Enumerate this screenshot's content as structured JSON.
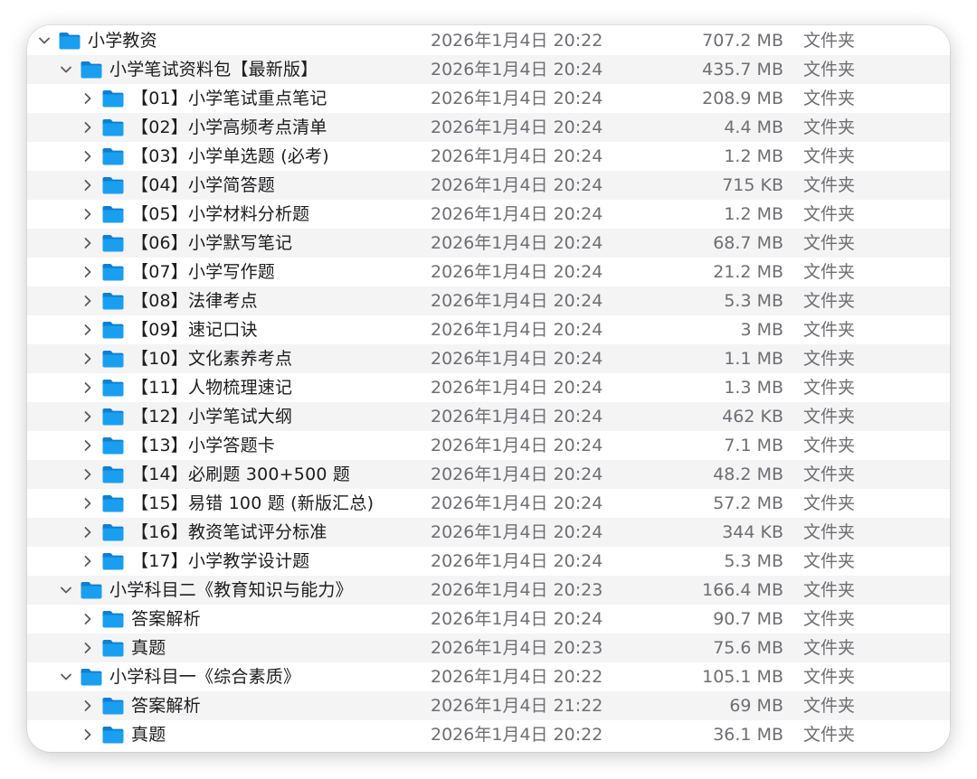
{
  "colors": {
    "folder_body": "#1a9ff0",
    "folder_tab": "#0f7fd0",
    "row_alt": "#f4f4f5",
    "muted_text": "#6e6e73"
  },
  "icons": {
    "expanded": "chevron-down-icon",
    "collapsed": "chevron-right-icon",
    "folder": "folder-icon"
  },
  "rows": [
    {
      "name": "小学教资",
      "date": "2026年1月4日 20:22",
      "size": "707.2 MB",
      "kind": "文件夹",
      "level": 0,
      "expanded": true
    },
    {
      "name": "小学笔试资料包【最新版】",
      "date": "2026年1月4日 20:24",
      "size": "435.7 MB",
      "kind": "文件夹",
      "level": 1,
      "expanded": true
    },
    {
      "name": "【01】小学笔试重点笔记",
      "date": "2026年1月4日 20:24",
      "size": "208.9 MB",
      "kind": "文件夹",
      "level": 2,
      "expanded": false
    },
    {
      "name": "【02】小学高频考点清单",
      "date": "2026年1月4日 20:24",
      "size": "4.4 MB",
      "kind": "文件夹",
      "level": 2,
      "expanded": false
    },
    {
      "name": "【03】小学单选题 (必考)",
      "date": "2026年1月4日 20:24",
      "size": "1.2 MB",
      "kind": "文件夹",
      "level": 2,
      "expanded": false
    },
    {
      "name": "【04】小学简答题",
      "date": "2026年1月4日 20:24",
      "size": "715 KB",
      "kind": "文件夹",
      "level": 2,
      "expanded": false
    },
    {
      "name": "【05】小学材料分析题",
      "date": "2026年1月4日 20:24",
      "size": "1.2 MB",
      "kind": "文件夹",
      "level": 2,
      "expanded": false
    },
    {
      "name": "【06】小学默写笔记",
      "date": "2026年1月4日 20:24",
      "size": "68.7 MB",
      "kind": "文件夹",
      "level": 2,
      "expanded": false
    },
    {
      "name": "【07】小学写作题",
      "date": "2026年1月4日 20:24",
      "size": "21.2 MB",
      "kind": "文件夹",
      "level": 2,
      "expanded": false
    },
    {
      "name": "【08】法律考点",
      "date": "2026年1月4日 20:24",
      "size": "5.3 MB",
      "kind": "文件夹",
      "level": 2,
      "expanded": false
    },
    {
      "name": "【09】速记口诀",
      "date": "2026年1月4日 20:24",
      "size": "3 MB",
      "kind": "文件夹",
      "level": 2,
      "expanded": false
    },
    {
      "name": "【10】文化素养考点",
      "date": "2026年1月4日 20:24",
      "size": "1.1 MB",
      "kind": "文件夹",
      "level": 2,
      "expanded": false
    },
    {
      "name": "【11】人物梳理速记",
      "date": "2026年1月4日 20:24",
      "size": "1.3 MB",
      "kind": "文件夹",
      "level": 2,
      "expanded": false
    },
    {
      "name": "【12】小学笔试大纲",
      "date": "2026年1月4日 20:24",
      "size": "462 KB",
      "kind": "文件夹",
      "level": 2,
      "expanded": false
    },
    {
      "name": "【13】小学答题卡",
      "date": "2026年1月4日 20:24",
      "size": "7.1 MB",
      "kind": "文件夹",
      "level": 2,
      "expanded": false
    },
    {
      "name": "【14】必刷题 300+500 题",
      "date": "2026年1月4日 20:24",
      "size": "48.2 MB",
      "kind": "文件夹",
      "level": 2,
      "expanded": false
    },
    {
      "name": "【15】易错 100 题 (新版汇总)",
      "date": "2026年1月4日 20:24",
      "size": "57.2 MB",
      "kind": "文件夹",
      "level": 2,
      "expanded": false
    },
    {
      "name": "【16】教资笔试评分标准",
      "date": "2026年1月4日 20:24",
      "size": "344 KB",
      "kind": "文件夹",
      "level": 2,
      "expanded": false
    },
    {
      "name": "【17】小学教学设计题",
      "date": "2026年1月4日 20:24",
      "size": "5.3 MB",
      "kind": "文件夹",
      "level": 2,
      "expanded": false
    },
    {
      "name": "小学科目二《教育知识与能力》",
      "date": "2026年1月4日 20:23",
      "size": "166.4 MB",
      "kind": "文件夹",
      "level": 1,
      "expanded": true
    },
    {
      "name": "答案解析",
      "date": "2026年1月4日 20:24",
      "size": "90.7 MB",
      "kind": "文件夹",
      "level": 2,
      "expanded": false
    },
    {
      "name": "真题",
      "date": "2026年1月4日 20:23",
      "size": "75.6 MB",
      "kind": "文件夹",
      "level": 2,
      "expanded": false
    },
    {
      "name": "小学科目一《综合素质》",
      "date": "2026年1月4日 20:22",
      "size": "105.1 MB",
      "kind": "文件夹",
      "level": 1,
      "expanded": true
    },
    {
      "name": "答案解析",
      "date": "2026年1月4日 21:22",
      "size": "69 MB",
      "kind": "文件夹",
      "level": 2,
      "expanded": false
    },
    {
      "name": "真题",
      "date": "2026年1月4日 20:22",
      "size": "36.1 MB",
      "kind": "文件夹",
      "level": 2,
      "expanded": false
    }
  ]
}
